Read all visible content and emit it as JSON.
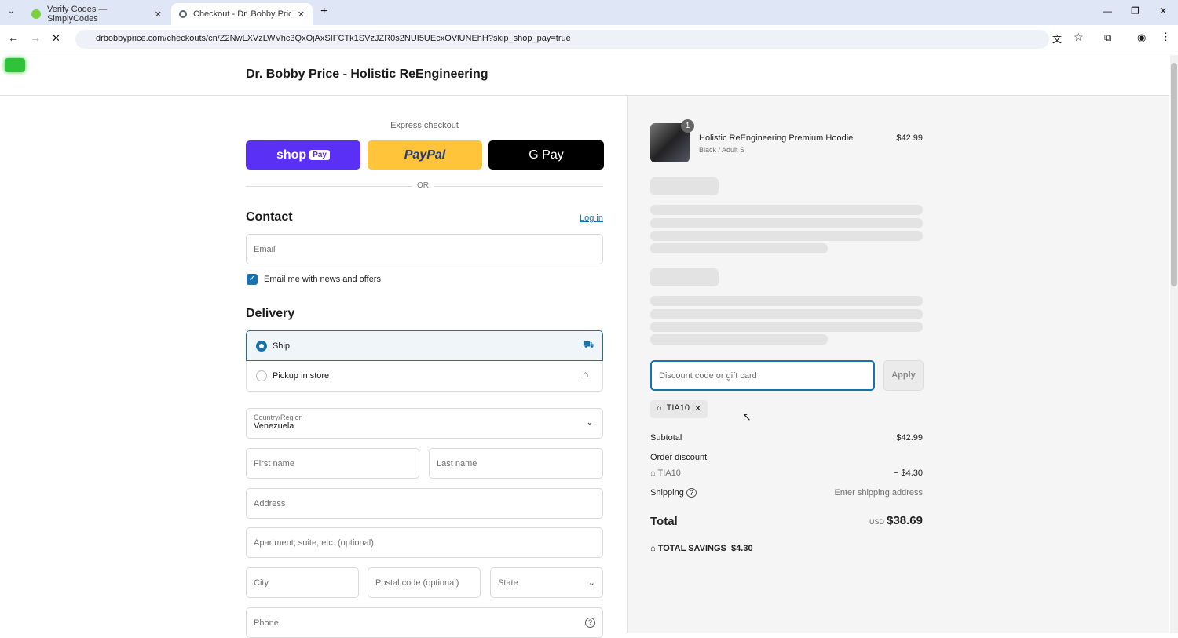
{
  "browser": {
    "tabs": [
      {
        "label": "Verify Codes — SimplyCodes"
      },
      {
        "label": "Checkout - Dr. Bobby Price - Ho"
      }
    ],
    "url": "drbobbyprice.com/checkouts/cn/Z2NwLXVzLWVhc3QxOjAxSIFCTk1SVzJZR0s2NUI5UEcxOVlUNEhH?skip_shop_pay=true"
  },
  "store": {
    "name": "Dr. Bobby Price - Holistic ReEngineering"
  },
  "express": {
    "title": "Express checkout",
    "shop": "shop",
    "shop_pay": "Pay",
    "paypal": "PayPal",
    "gpay": "G Pay",
    "or": "OR"
  },
  "contact": {
    "title": "Contact",
    "login": "Log in",
    "email_placeholder": "Email",
    "news": "Email me with news and offers"
  },
  "delivery": {
    "title": "Delivery",
    "ship": "Ship",
    "pickup": "Pickup in store",
    "country_label": "Country/Region",
    "country": "Venezuela",
    "first": "First name",
    "last": "Last name",
    "address": "Address",
    "apt": "Apartment, suite, etc. (optional)",
    "city": "City",
    "postal": "Postal code (optional)",
    "state": "State",
    "phone": "Phone"
  },
  "summary": {
    "qty": "1",
    "product": "Holistic ReEngineering Premium Hoodie",
    "variant": "Black / Adult S",
    "price": "$42.99",
    "discount_placeholder": "Discount code or gift card",
    "apply": "Apply",
    "code": "TIA10",
    "subtotal_label": "Subtotal",
    "subtotal": "$42.99",
    "order_discount": "Order discount",
    "discount_code": "TIA10",
    "discount": "− $4.30",
    "shipping_label": "Shipping",
    "shipping": "Enter shipping address",
    "total_label": "Total",
    "currency": "USD",
    "total": "$38.69",
    "savings_label": "TOTAL SAVINGS",
    "savings": "$4.30"
  }
}
